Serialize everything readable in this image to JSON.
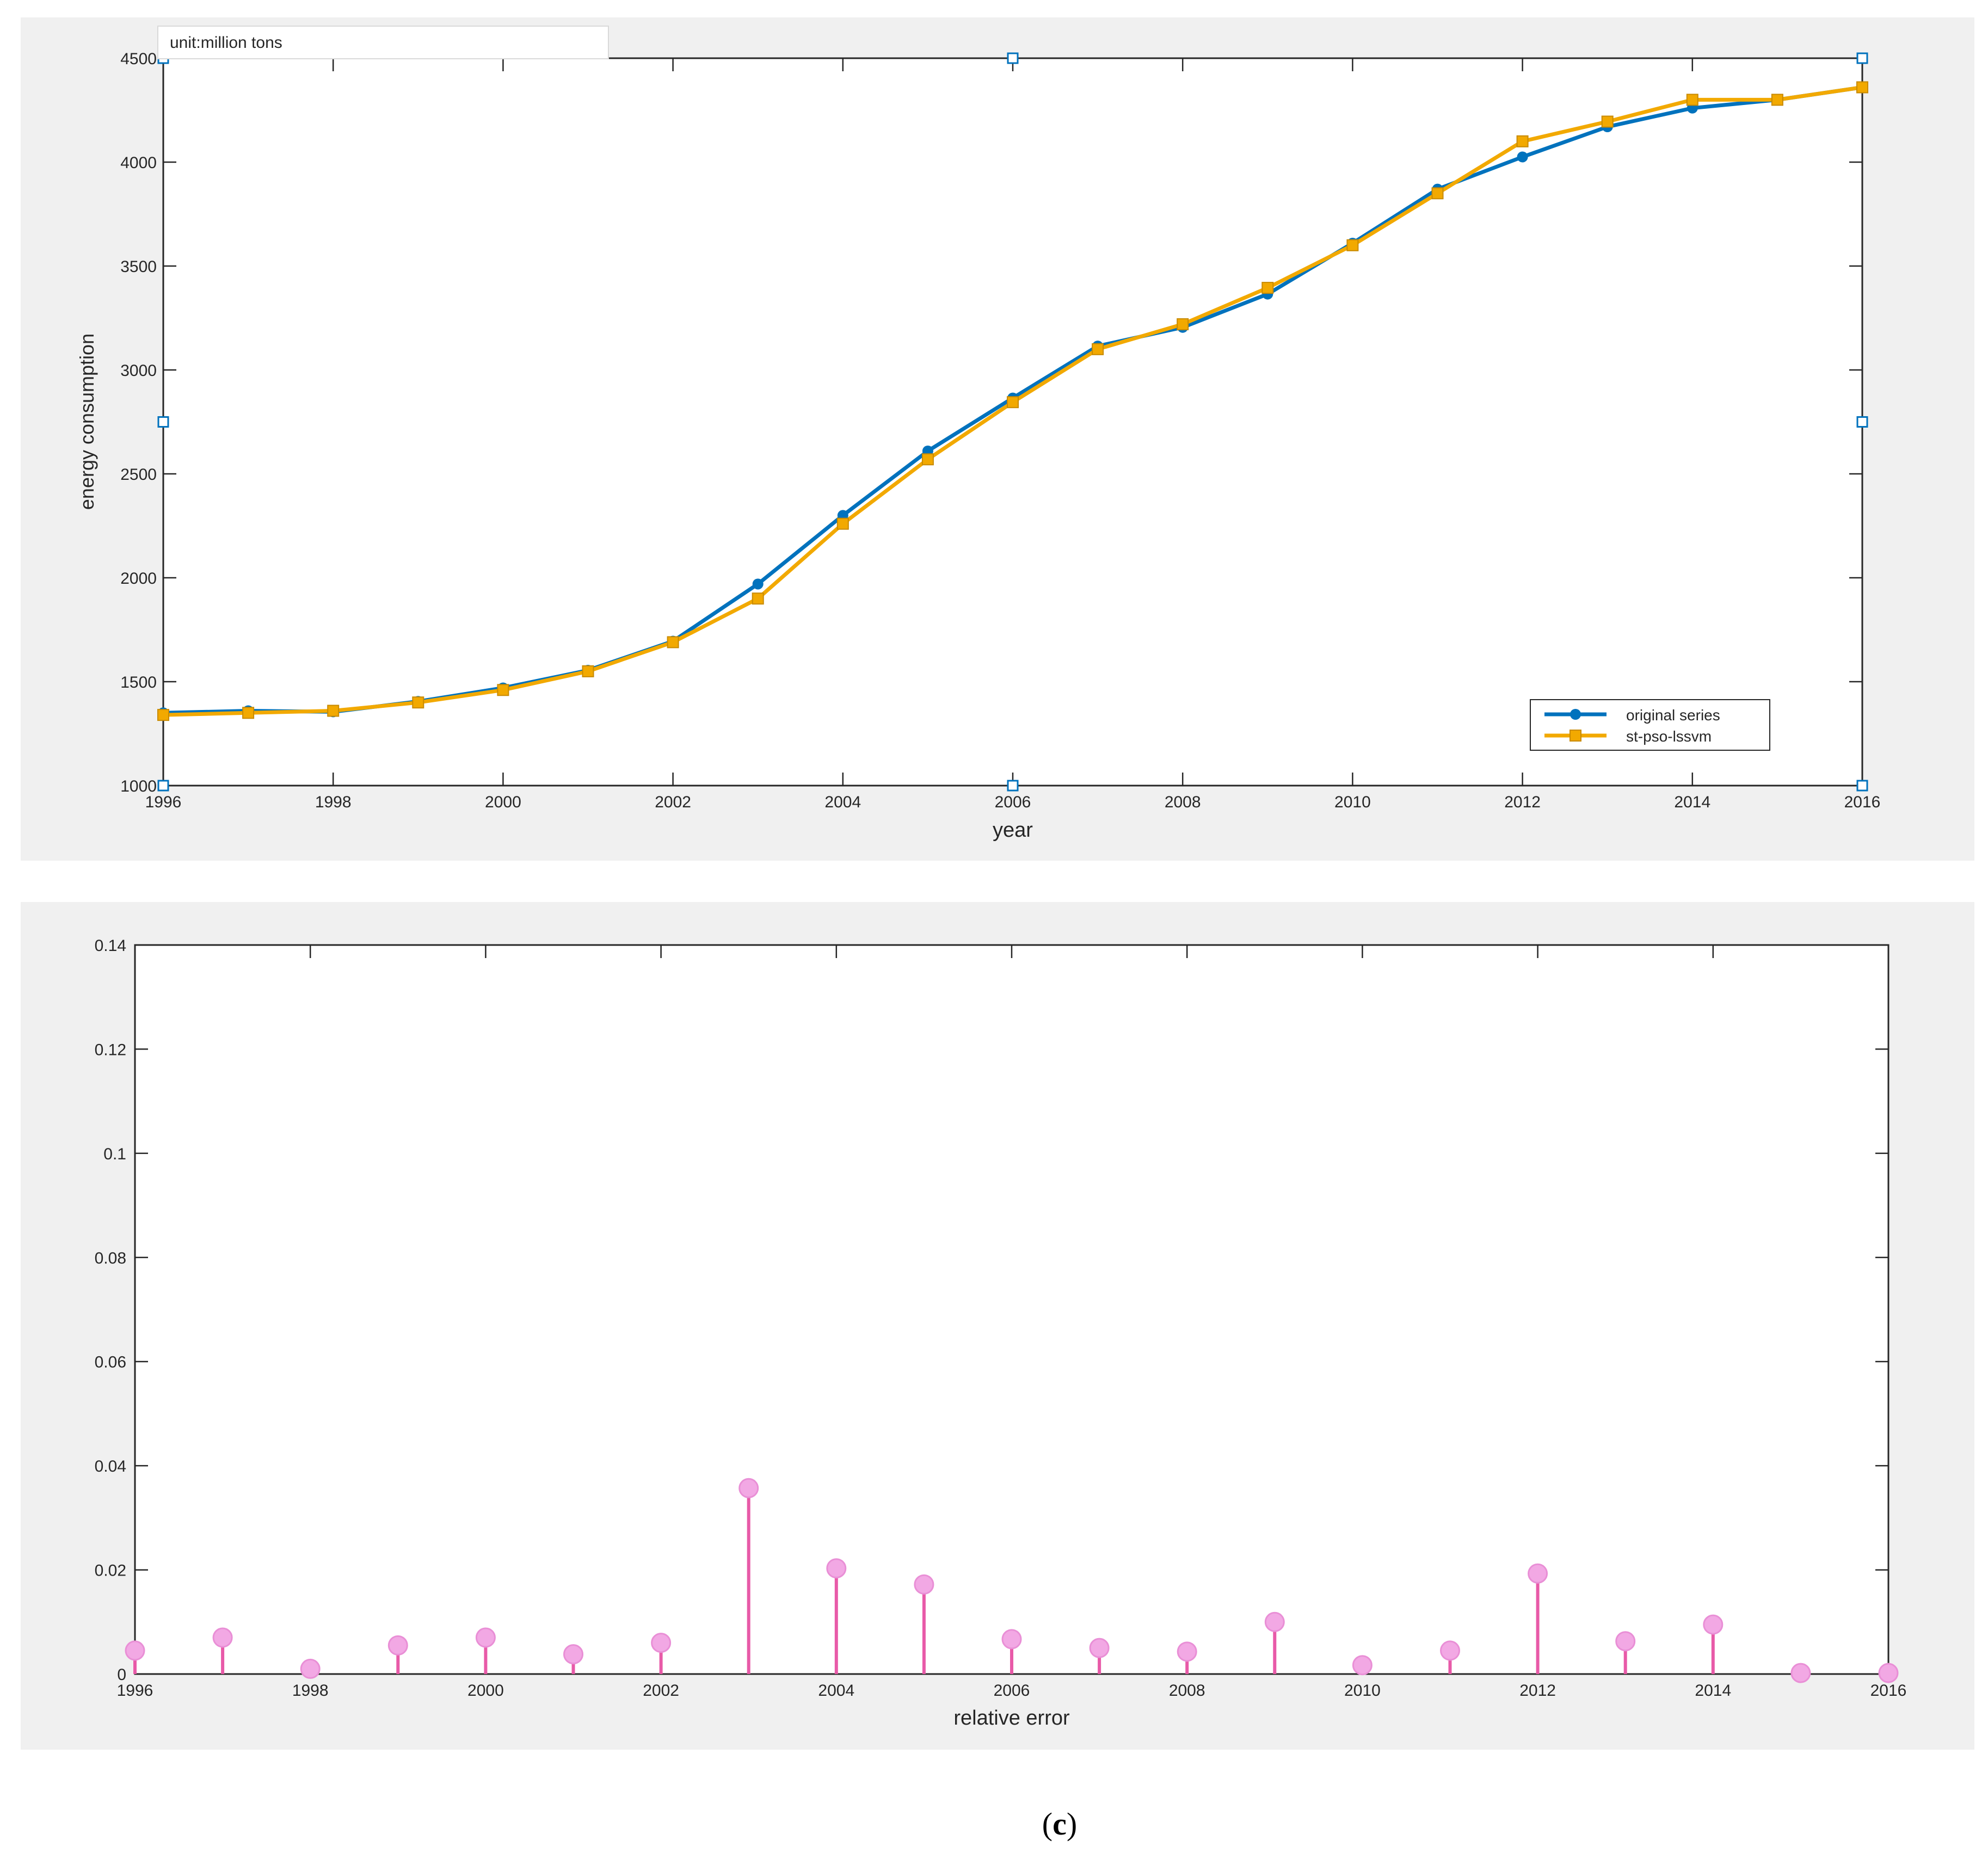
{
  "caption": {
    "open": "(",
    "letter": "c",
    "close": ")"
  },
  "chart_data": [
    {
      "type": "line",
      "annotation": "unit:million tons",
      "xlabel": "year",
      "ylabel": "energy consumption",
      "xlim": [
        1996,
        2016
      ],
      "ylim": [
        1000,
        4500
      ],
      "xticks": [
        1996,
        1998,
        2000,
        2002,
        2004,
        2006,
        2008,
        2010,
        2012,
        2014,
        2016
      ],
      "yticks": [
        1000,
        1500,
        2000,
        2500,
        3000,
        3500,
        4000,
        4500
      ],
      "grid": false,
      "legend_position": "bottom-right",
      "x": [
        1996,
        1997,
        1998,
        1999,
        2000,
        2001,
        2002,
        2003,
        2004,
        2005,
        2006,
        2007,
        2008,
        2009,
        2010,
        2011,
        2012,
        2013,
        2014,
        2015,
        2016
      ],
      "series": [
        {
          "name": "original series",
          "color": "#0072BD",
          "marker": "circle",
          "values": [
            1350,
            1360,
            1355,
            1405,
            1470,
            1555,
            1695,
            1970,
            2300,
            2610,
            2865,
            3115,
            3205,
            3365,
            3610,
            3870,
            4025,
            4170,
            4260,
            4300,
            4360
          ]
        },
        {
          "name": "st-pso-lssvm",
          "color": "#F2A900",
          "marker": "square",
          "values": [
            1340,
            1350,
            1360,
            1400,
            1460,
            1550,
            1690,
            1900,
            2260,
            2570,
            2845,
            3100,
            3220,
            3395,
            3600,
            3850,
            4100,
            4195,
            4300,
            4300,
            4360
          ]
        }
      ],
      "selection_handle_color": "#0072BD"
    },
    {
      "type": "stem",
      "xlabel": "relative error",
      "ylabel": "",
      "xlim": [
        1996,
        2016
      ],
      "ylim": [
        0,
        0.14
      ],
      "xticks": [
        1996,
        1998,
        2000,
        2002,
        2004,
        2006,
        2008,
        2010,
        2012,
        2014,
        2016
      ],
      "yticks": [
        0,
        0.02,
        0.04,
        0.06,
        0.08,
        0.1,
        0.12,
        0.14
      ],
      "ytick_labels": [
        "0",
        "0.02",
        "0.04",
        "0.06",
        "0.08",
        "0.1",
        "0.12",
        "0.14"
      ],
      "grid": false,
      "x": [
        1996,
        1997,
        1998,
        1999,
        2000,
        2001,
        2002,
        2003,
        2004,
        2005,
        2006,
        2007,
        2008,
        2009,
        2010,
        2011,
        2012,
        2013,
        2014,
        2015,
        2016
      ],
      "values": [
        0.0045,
        0.007,
        0.001,
        0.0055,
        0.007,
        0.0038,
        0.006,
        0.0357,
        0.0203,
        0.0172,
        0.0067,
        0.005,
        0.0043,
        0.01,
        0.0017,
        0.0045,
        0.0193,
        0.0063,
        0.0095,
        0.0002,
        0.0002
      ],
      "color": "#E85AA8",
      "marker_color": "#F2A8E4"
    }
  ]
}
